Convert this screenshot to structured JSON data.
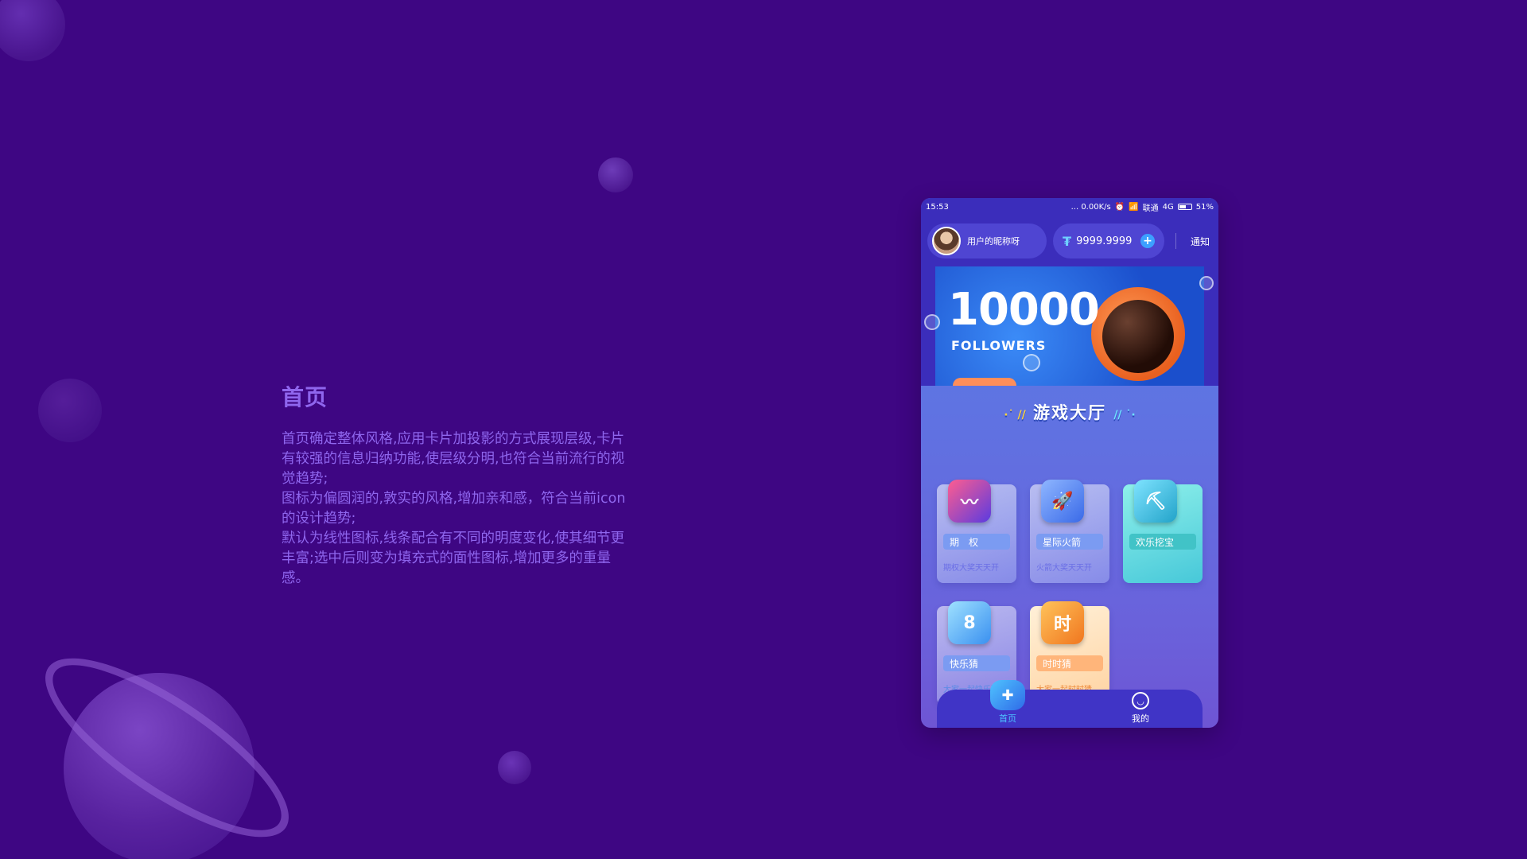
{
  "description": {
    "title": "首页",
    "paragraphs": [
      "首页确定整体风格,应用卡片加投影的方式展现层级,卡片有较强的信息归纳功能,使层级分明,也符合当前流行的视觉趋势;",
      "图标为偏圆润的,敦实的风格,增加亲和感，符合当前icon的设计趋势;",
      "默认为线性图标,线条配合有不同的明度变化,使其细节更丰富;选中后则变为填充式的面性图标,增加更多的重量感。"
    ]
  },
  "statusbar": {
    "time": "15:53",
    "speed": "... 0.00K/s",
    "carrier": "联通",
    "network": "4G",
    "battery": "51%"
  },
  "topbar": {
    "nickname": "用户的昵称呀",
    "balance": "9999.9999",
    "notify": "通知"
  },
  "banner": {
    "headline": "10000",
    "subline": "FOLLOWERS"
  },
  "section": {
    "title": "游戏大厅"
  },
  "games": [
    {
      "name": "期　权",
      "sub": "期权大奖天天开"
    },
    {
      "name": "星际火箭",
      "sub": "火箭大奖天天开"
    },
    {
      "name": "欢乐挖宝",
      "sub": ""
    },
    {
      "name": "快乐猜",
      "sub": "大家一起快乐猜"
    },
    {
      "name": "时时猜",
      "sub": "大家一起时时猜"
    }
  ],
  "nav": {
    "home": "首页",
    "mine": "我的"
  },
  "colors": {
    "background": "#3e0683",
    "accent_text": "#8f66ee",
    "topbar": "#3b2dbb"
  }
}
